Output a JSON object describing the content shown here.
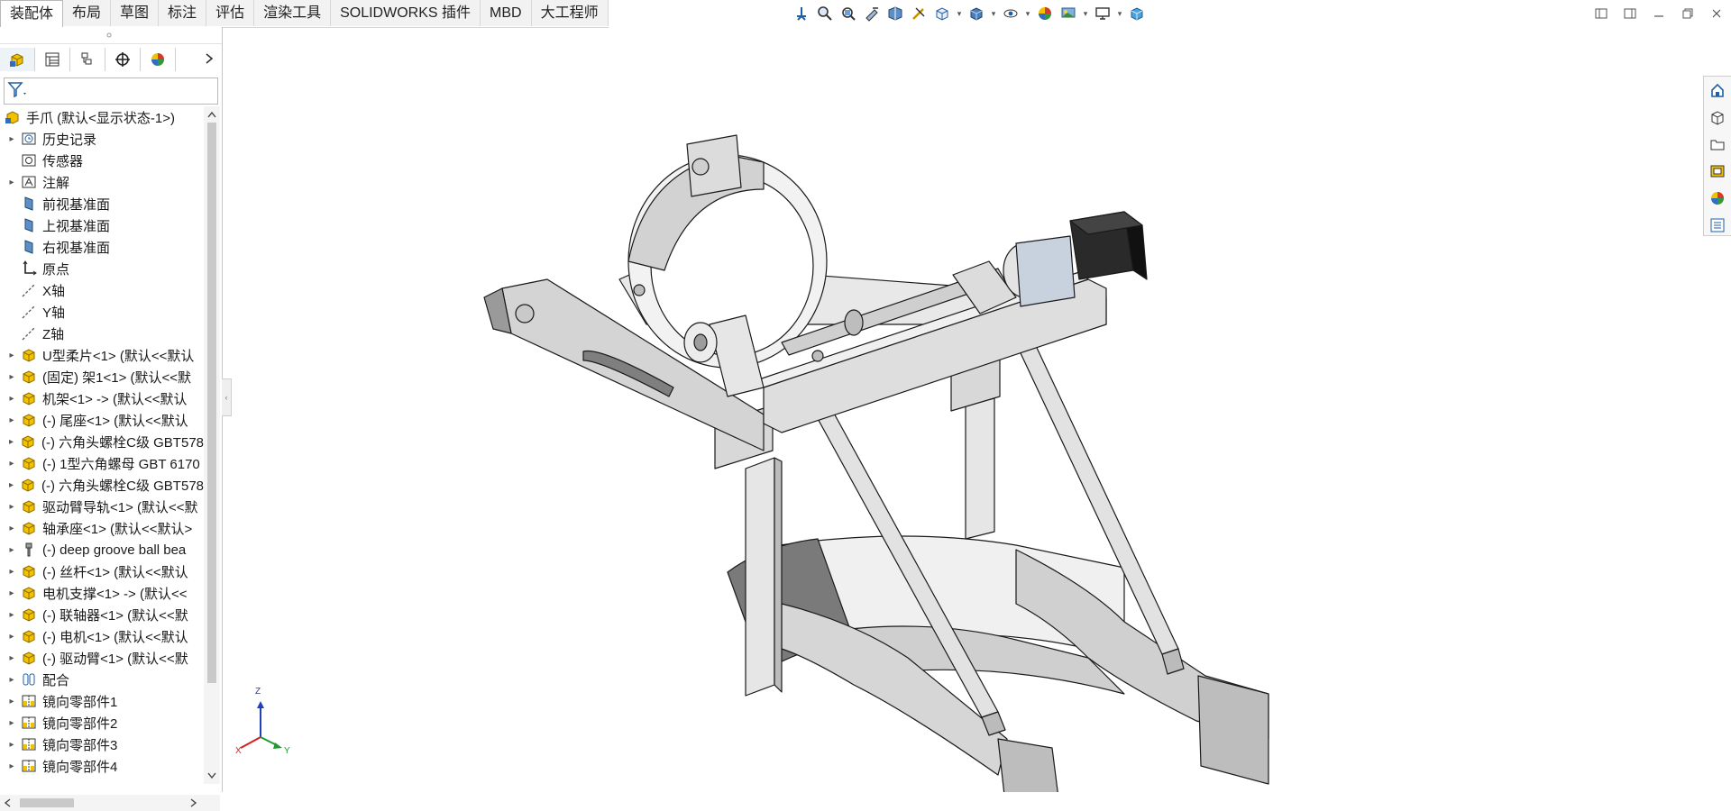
{
  "tabs": [
    "装配体",
    "布局",
    "草图",
    "标注",
    "评估",
    "渲染工具",
    "SOLIDWORKS 插件",
    "MBD",
    "大工程师"
  ],
  "active_tab": "装配体",
  "heads_up_toolbar": [
    "view-orientation-icon",
    "zoom-to-fit-icon",
    "zoom-to-area-icon",
    "previous-view-icon",
    "section-view-icon",
    "dynamic-annotation-icon",
    "view-orientation-cube-icon",
    "display-style-icon",
    "hide-show-items-icon",
    "edit-appearance-icon",
    "apply-scene-icon",
    "view-settings-icon",
    "3d-view-icon"
  ],
  "feature_tree": {
    "root": "手爪  (默认<显示状态-1>)",
    "items": [
      {
        "label": "历史记录",
        "icon": "history-folder-icon",
        "expander": true
      },
      {
        "label": "传感器",
        "icon": "sensor-icon",
        "expander": false
      },
      {
        "label": "注解",
        "icon": "annotation-icon",
        "expander": true
      },
      {
        "label": "前视基准面",
        "icon": "plane-icon",
        "expander": false
      },
      {
        "label": "上视基准面",
        "icon": "plane-icon",
        "expander": false
      },
      {
        "label": "右视基准面",
        "icon": "plane-icon",
        "expander": false
      },
      {
        "label": "原点",
        "icon": "origin-icon",
        "expander": false
      },
      {
        "label": "X轴",
        "icon": "axis-icon",
        "expander": false
      },
      {
        "label": "Y轴",
        "icon": "axis-icon",
        "expander": false
      },
      {
        "label": "Z轴",
        "icon": "axis-icon",
        "expander": false
      },
      {
        "label": "U型柔片<1> (默认<<默认",
        "icon": "part-icon",
        "expander": true
      },
      {
        "label": "(固定) 架1<1> (默认<<默",
        "icon": "part-icon",
        "expander": true
      },
      {
        "label": "机架<1> -> (默认<<默认",
        "icon": "part-icon",
        "expander": true
      },
      {
        "label": "(-) 尾座<1> (默认<<默认",
        "icon": "part-icon",
        "expander": true
      },
      {
        "label": "(-) 六角头螺栓C级 GBT578",
        "icon": "part-icon",
        "expander": true
      },
      {
        "label": "(-) 1型六角螺母 GBT 6170",
        "icon": "part-icon",
        "expander": true
      },
      {
        "label": "(-) 六角头螺栓C级 GBT578",
        "icon": "part-icon",
        "expander": true
      },
      {
        "label": "驱动臂导轨<1> (默认<<默",
        "icon": "part-icon",
        "expander": true
      },
      {
        "label": "轴承座<1> (默认<<默认>",
        "icon": "part-icon",
        "expander": true
      },
      {
        "label": "(-) deep groove ball bea",
        "icon": "toolbox-part-icon",
        "expander": true
      },
      {
        "label": "(-) 丝杆<1> (默认<<默认",
        "icon": "part-icon",
        "expander": true
      },
      {
        "label": "电机支撑<1> -> (默认<<",
        "icon": "part-icon",
        "expander": true
      },
      {
        "label": "(-) 联轴器<1> (默认<<默",
        "icon": "part-icon",
        "expander": true
      },
      {
        "label": "(-) 电机<1> (默认<<默认",
        "icon": "part-icon",
        "expander": true
      },
      {
        "label": "(-) 驱动臂<1> (默认<<默",
        "icon": "part-icon",
        "expander": true
      },
      {
        "label": "配合",
        "icon": "mates-icon",
        "expander": true
      },
      {
        "label": "镜向零部件1",
        "icon": "mirror-component-icon",
        "expander": true
      },
      {
        "label": "镜向零部件2",
        "icon": "mirror-component-icon",
        "expander": true
      },
      {
        "label": "镜向零部件3",
        "icon": "mirror-component-icon",
        "expander": true
      },
      {
        "label": "镜向零部件4",
        "icon": "mirror-component-icon",
        "expander": true
      }
    ]
  },
  "triad": {
    "x": "X",
    "y": "Y",
    "z": "Z"
  },
  "task_pane": [
    "home-icon",
    "design-library-icon",
    "file-explorer-icon",
    "view-palette-icon",
    "appearances-icon",
    "custom-properties-icon"
  ],
  "colors": {
    "accent": "#1e5fa8",
    "part_yellow": "#e8b400",
    "model_face": "#d9d9d9",
    "model_edge": "#1a1a1a"
  }
}
